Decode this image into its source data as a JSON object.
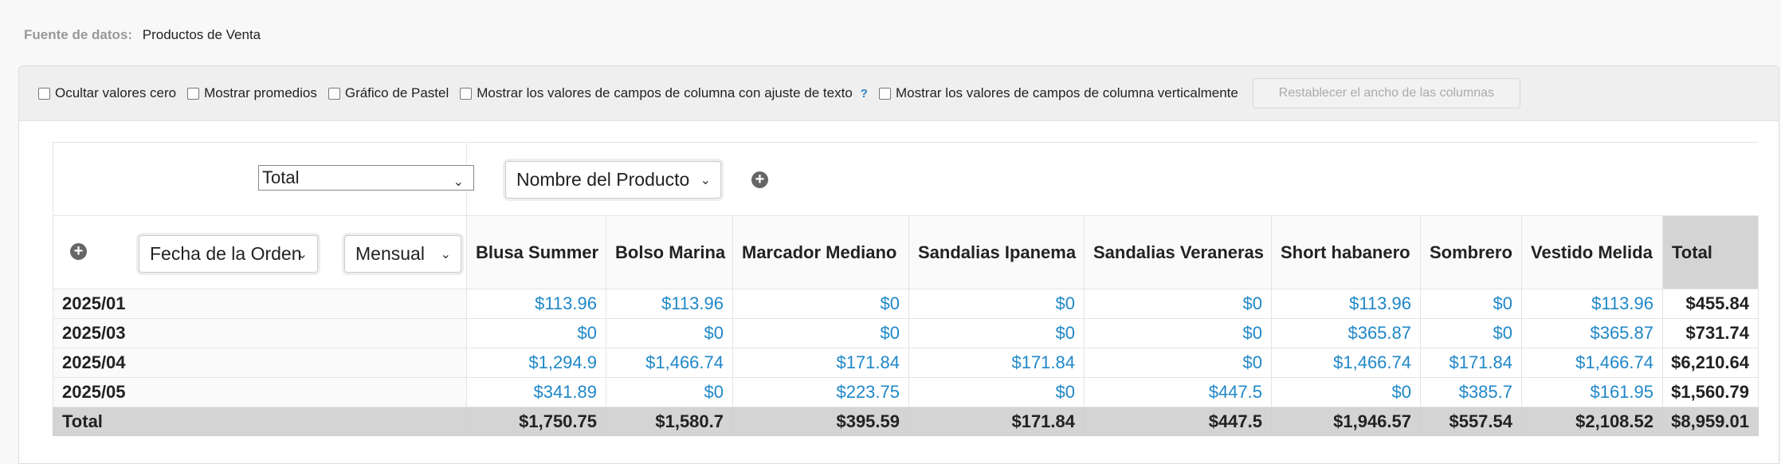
{
  "datasource": {
    "label": "Fuente de datos:",
    "value": "Productos de Venta"
  },
  "toolbar": {
    "options": [
      "Ocultar valores cero",
      "Mostrar promedios",
      "Gráfico de Pastel",
      "Mostrar los valores de campos de columna con ajuste de texto",
      "Mostrar los valores de campos de columna verticalmente"
    ],
    "help": "?",
    "reset_label": "Restablecer el ancho de las columnas"
  },
  "pivot": {
    "measure_select": "Total",
    "column_field_select": "Nombre del Producto",
    "row_field_select": "Fecha de la Orden",
    "period_select": "Mensual",
    "columns": [
      "Blusa Summer",
      "Bolso Marina",
      "Marcador Mediano",
      "Sandalias Ipanema",
      "Sandalias Veraneras",
      "Short habanero",
      "Sombrero",
      "Vestido Melida",
      "Total"
    ],
    "rows": [
      {
        "label": "2025/01",
        "values": [
          "$113.96",
          "$113.96",
          "$0",
          "$0",
          "$0",
          "$113.96",
          "$0",
          "$113.96"
        ],
        "total": "$455.84"
      },
      {
        "label": "2025/03",
        "values": [
          "$0",
          "$0",
          "$0",
          "$0",
          "$0",
          "$365.87",
          "$0",
          "$365.87"
        ],
        "total": "$731.74"
      },
      {
        "label": "2025/04",
        "values": [
          "$1,294.9",
          "$1,466.74",
          "$171.84",
          "$171.84",
          "$0",
          "$1,466.74",
          "$171.84",
          "$1,466.74"
        ],
        "total": "$6,210.64"
      },
      {
        "label": "2025/05",
        "values": [
          "$341.89",
          "$0",
          "$223.75",
          "$0",
          "$447.5",
          "$0",
          "$385.7",
          "$161.95"
        ],
        "total": "$1,560.79"
      }
    ],
    "footer": {
      "label": "Total",
      "values": [
        "$1,750.75",
        "$1,580.7",
        "$395.59",
        "$171.84",
        "$447.5",
        "$1,946.57",
        "$557.54",
        "$2,108.52"
      ],
      "total": "$8,959.01"
    }
  }
}
